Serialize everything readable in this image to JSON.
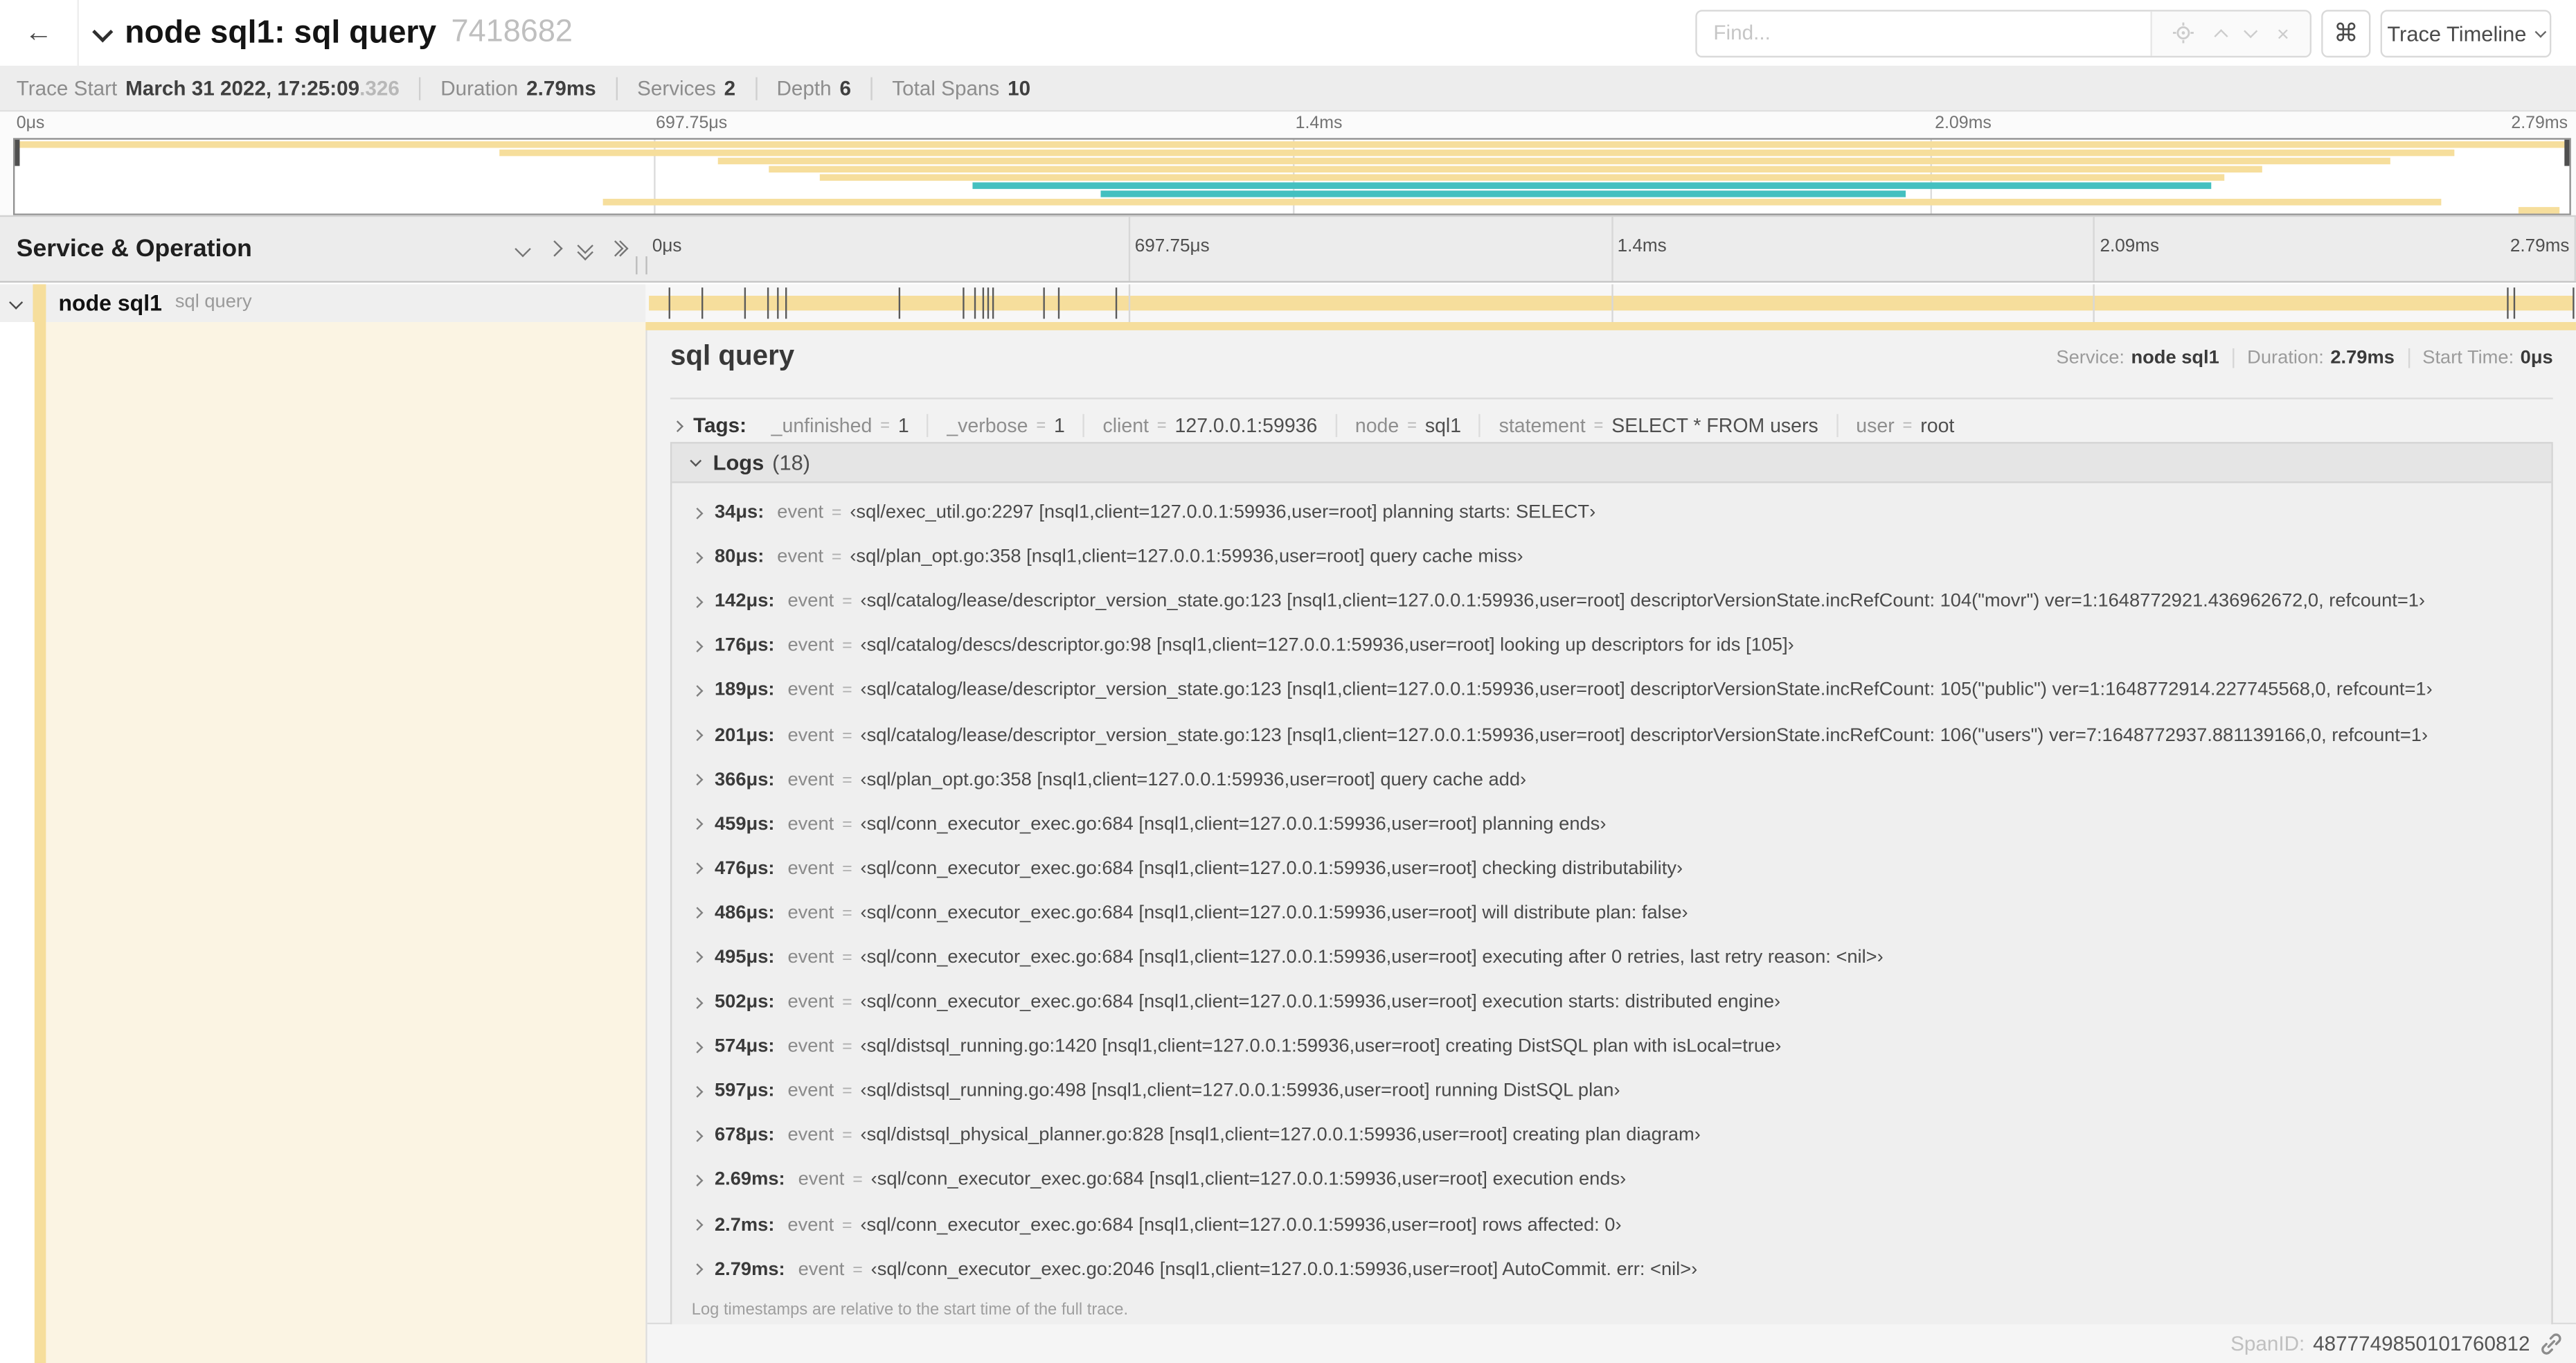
{
  "header": {
    "title": "node sql1: sql query",
    "trace_id": "7418682",
    "back_icon": "←",
    "find_placeholder": "Find...",
    "shortcut_icon": "⌘",
    "view_button": "Trace Timeline"
  },
  "trace_info": [
    {
      "label": "Trace Start",
      "value": "March 31 2022, 17:25:09",
      "suffix": ".326"
    },
    {
      "label": "Duration",
      "value": "2.79ms"
    },
    {
      "label": "Services",
      "value": "2"
    },
    {
      "label": "Depth",
      "value": "6"
    },
    {
      "label": "Total Spans",
      "value": "10"
    }
  ],
  "time_ticks": [
    {
      "label": "0μs",
      "pct": 0
    },
    {
      "label": "697.75μs",
      "pct": 25
    },
    {
      "label": "1.4ms",
      "pct": 50
    },
    {
      "label": "2.09ms",
      "pct": 75
    },
    {
      "label": "2.79ms",
      "pct": 100
    }
  ],
  "minimap": {
    "spans": [
      {
        "row": 0,
        "start": 0,
        "end": 100,
        "color": "tan"
      },
      {
        "row": 1,
        "start": 19,
        "end": 95.5,
        "color": "tan"
      },
      {
        "row": 2,
        "start": 27.5,
        "end": 93,
        "color": "tan"
      },
      {
        "row": 3,
        "start": 29.5,
        "end": 88,
        "color": "tan"
      },
      {
        "row": 4,
        "start": 31.5,
        "end": 86.5,
        "color": "tan"
      },
      {
        "row": 5,
        "start": 37.5,
        "end": 86,
        "color": "teal"
      },
      {
        "row": 6,
        "start": 42.5,
        "end": 74,
        "color": "teal"
      },
      {
        "row": 7,
        "start": 23,
        "end": 95,
        "color": "tan"
      },
      {
        "row": 8,
        "start": 98,
        "end": 99.6,
        "color": "tan"
      }
    ]
  },
  "timeline": {
    "column_header": "Service & Operation",
    "row": {
      "service": "node sql1",
      "operation": "sql query"
    },
    "log_markers_pct": [
      1.22,
      2.87,
      5.09,
      6.31,
      6.77,
      7.2,
      13.12,
      16.45,
      17.06,
      17.42,
      17.74,
      17.99,
      20.57,
      21.4,
      24.3,
      96.42,
      96.77,
      99.85
    ]
  },
  "detail": {
    "operation": "sql query",
    "summary": [
      {
        "label": "Service:",
        "value": "node sql1"
      },
      {
        "label": "Duration:",
        "value": "2.79ms"
      },
      {
        "label": "Start Time:",
        "value": "0μs"
      }
    ],
    "tags_label": "Tags:",
    "tags": [
      {
        "key": "_unfinished",
        "value": "1"
      },
      {
        "key": "_verbose",
        "value": "1"
      },
      {
        "key": "client",
        "value": "127.0.0.1:59936"
      },
      {
        "key": "node",
        "value": "sql1"
      },
      {
        "key": "statement",
        "value": "SELECT * FROM users"
      },
      {
        "key": "user",
        "value": "root"
      }
    ],
    "logs_label": "Logs",
    "logs_count": "(18)",
    "log_field": "event",
    "logs": [
      {
        "time": "34μs:",
        "value": "‹sql/exec_util.go:2297 [nsql1,client=127.0.0.1:59936,user=root] planning starts: SELECT›"
      },
      {
        "time": "80μs:",
        "value": "‹sql/plan_opt.go:358 [nsql1,client=127.0.0.1:59936,user=root] query cache miss›"
      },
      {
        "time": "142μs:",
        "value": "‹sql/catalog/lease/descriptor_version_state.go:123 [nsql1,client=127.0.0.1:59936,user=root] descriptorVersionState.incRefCount: 104(\"movr\") ver=1:1648772921.436962672,0, refcount=1›"
      },
      {
        "time": "176μs:",
        "value": "‹sql/catalog/descs/descriptor.go:98 [nsql1,client=127.0.0.1:59936,user=root] looking up descriptors for ids [105]›"
      },
      {
        "time": "189μs:",
        "value": "‹sql/catalog/lease/descriptor_version_state.go:123 [nsql1,client=127.0.0.1:59936,user=root] descriptorVersionState.incRefCount: 105(\"public\") ver=1:1648772914.227745568,0, refcount=1›"
      },
      {
        "time": "201μs:",
        "value": "‹sql/catalog/lease/descriptor_version_state.go:123 [nsql1,client=127.0.0.1:59936,user=root] descriptorVersionState.incRefCount: 106(\"users\") ver=7:1648772937.881139166,0, refcount=1›"
      },
      {
        "time": "366μs:",
        "value": "‹sql/plan_opt.go:358 [nsql1,client=127.0.0.1:59936,user=root] query cache add›"
      },
      {
        "time": "459μs:",
        "value": "‹sql/conn_executor_exec.go:684 [nsql1,client=127.0.0.1:59936,user=root] planning ends›"
      },
      {
        "time": "476μs:",
        "value": "‹sql/conn_executor_exec.go:684 [nsql1,client=127.0.0.1:59936,user=root] checking distributability›"
      },
      {
        "time": "486μs:",
        "value": "‹sql/conn_executor_exec.go:684 [nsql1,client=127.0.0.1:59936,user=root] will distribute plan: false›"
      },
      {
        "time": "495μs:",
        "value": "‹sql/conn_executor_exec.go:684 [nsql1,client=127.0.0.1:59936,user=root] executing after 0 retries, last retry reason: <nil>›"
      },
      {
        "time": "502μs:",
        "value": "‹sql/conn_executor_exec.go:684 [nsql1,client=127.0.0.1:59936,user=root] execution starts: distributed engine›"
      },
      {
        "time": "574μs:",
        "value": "‹sql/distsql_running.go:1420 [nsql1,client=127.0.0.1:59936,user=root] creating DistSQL plan with isLocal=true›"
      },
      {
        "time": "597μs:",
        "value": "‹sql/distsql_running.go:498 [nsql1,client=127.0.0.1:59936,user=root] running DistSQL plan›"
      },
      {
        "time": "678μs:",
        "value": "‹sql/distsql_physical_planner.go:828 [nsql1,client=127.0.0.1:59936,user=root] creating plan diagram›"
      },
      {
        "time": "2.69ms:",
        "value": "‹sql/conn_executor_exec.go:684 [nsql1,client=127.0.0.1:59936,user=root] execution ends›"
      },
      {
        "time": "2.7ms:",
        "value": "‹sql/conn_executor_exec.go:684 [nsql1,client=127.0.0.1:59936,user=root] rows affected: 0›"
      },
      {
        "time": "2.79ms:",
        "value": "‹sql/conn_executor_exec.go:2046 [nsql1,client=127.0.0.1:59936,user=root] AutoCommit. err: <nil>›"
      }
    ],
    "logs_note": "Log timestamps are relative to the start time of the full trace.",
    "spanid_label": "SpanID:",
    "spanid_value": "4877749850101760812"
  },
  "colors": {
    "span_tan": "#F6DE9C",
    "span_teal": "#44C0C0",
    "left_panel_cream": "#FBF4E3"
  }
}
